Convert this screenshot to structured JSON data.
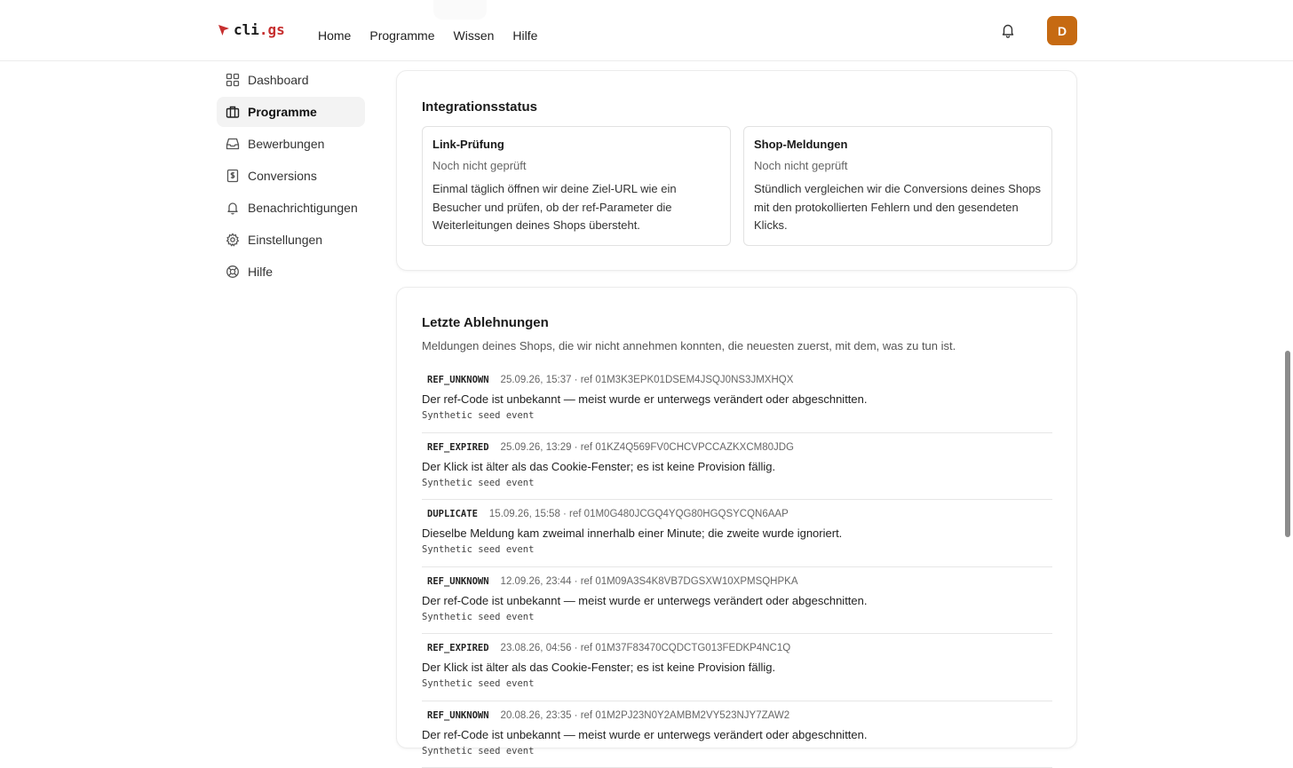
{
  "header": {
    "logo_prefix": "cli",
    "logo_tld": ".gs",
    "nav": [
      "Home",
      "Programme",
      "Wissen",
      "Hilfe"
    ],
    "avatar_initial": "D",
    "avatar_color": "#c66a12",
    "accent_color": "#c62f2f"
  },
  "sidebar": {
    "items": [
      {
        "label": "Dashboard",
        "icon": "grid-icon"
      },
      {
        "label": "Programme",
        "icon": "briefcase-icon",
        "active": true
      },
      {
        "label": "Bewerbungen",
        "icon": "inbox-icon"
      },
      {
        "label": "Conversions",
        "icon": "receipt-icon"
      },
      {
        "label": "Benachrichtigungen",
        "icon": "bell-icon"
      },
      {
        "label": "Einstellungen",
        "icon": "gear-icon"
      },
      {
        "label": "Hilfe",
        "icon": "lifebuoy-icon"
      }
    ]
  },
  "integration": {
    "title": "Integrationsstatus",
    "boxes": [
      {
        "title": "Link-Prüfung",
        "status": "Noch nicht geprüft",
        "desc": "Einmal täglich öffnen wir deine Ziel-URL wie ein Besucher und prüfen, ob der ref-Parameter die Weiterleitungen deines Shops übersteht."
      },
      {
        "title": "Shop-Meldungen",
        "status": "Noch nicht geprüft",
        "desc": "Stündlich vergleichen wir die Conversions deines Shops mit den protokollierten Fehlern und den gesendeten Klicks."
      }
    ]
  },
  "rejections": {
    "title": "Letzte Ablehnungen",
    "subtitle": "Meldungen deines Shops, die wir nicht annehmen konnten, die neuesten zuerst, mit dem, was zu tun ist.",
    "events": [
      {
        "code": "REF_UNKNOWN",
        "stamp": "25.09.26, 15:37 · ref 01M3K3EPK01DSEM4JSQJ0NS3JMXHQX",
        "msg": "Der ref-Code ist unbekannt — meist wurde er unterwegs verändert oder abgeschnitten.",
        "note": "Synthetic seed event"
      },
      {
        "code": "REF_EXPIRED",
        "stamp": "25.09.26, 13:29 · ref 01KZ4Q569FV0CHCVPCCAZKXCM80JDG",
        "msg": "Der Klick ist älter als das Cookie-Fenster; es ist keine Provision fällig.",
        "note": "Synthetic seed event"
      },
      {
        "code": "DUPLICATE",
        "stamp": "15.09.26, 15:58 · ref 01M0G480JCGQ4YQG80HGQSYCQN6AAP",
        "msg": "Dieselbe Meldung kam zweimal innerhalb einer Minute; die zweite wurde ignoriert.",
        "note": "Synthetic seed event"
      },
      {
        "code": "REF_UNKNOWN",
        "stamp": "12.09.26, 23:44 · ref 01M09A3S4K8VB7DGSXW10XPMSQHPKA",
        "msg": "Der ref-Code ist unbekannt — meist wurde er unterwegs verändert oder abgeschnitten.",
        "note": "Synthetic seed event"
      },
      {
        "code": "REF_EXPIRED",
        "stamp": "23.08.26, 04:56 · ref 01M37F83470CQDCTG013FEDKP4NC1Q",
        "msg": "Der Klick ist älter als das Cookie-Fenster; es ist keine Provision fällig.",
        "note": "Synthetic seed event"
      },
      {
        "code": "REF_UNKNOWN",
        "stamp": "20.08.26, 23:35 · ref 01M2PJ23N0Y2AMBM2VY523NJY7ZAW2",
        "msg": "Der ref-Code ist unbekannt — meist wurde er unterwegs verändert oder abgeschnitten.",
        "note": "Synthetic seed event"
      }
    ]
  }
}
